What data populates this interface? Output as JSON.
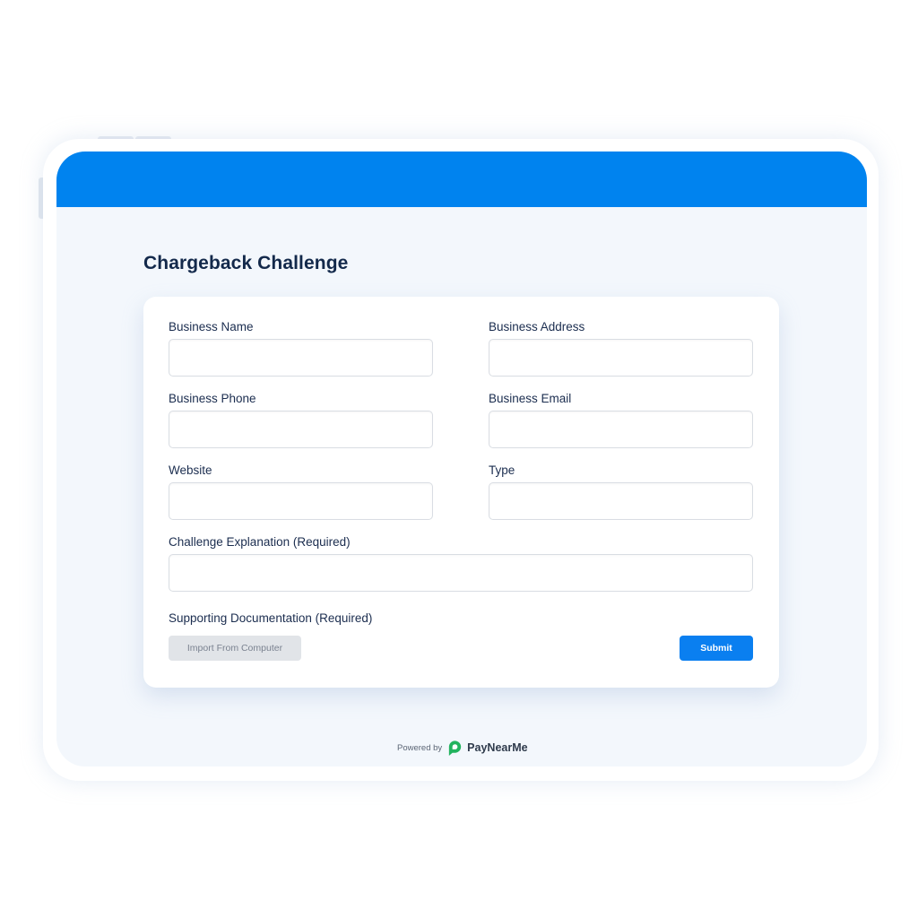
{
  "colors": {
    "header_blue": "#0083ef",
    "submit_blue": "#0a7ff0",
    "logo_green": "#22b35e"
  },
  "form": {
    "title": "Chargeback Challenge",
    "fields": {
      "business_name": {
        "label": "Business Name",
        "value": ""
      },
      "business_address": {
        "label": "Business Address",
        "value": ""
      },
      "business_phone": {
        "label": "Business Phone",
        "value": ""
      },
      "business_email": {
        "label": "Business Email",
        "value": ""
      },
      "website": {
        "label": "Website",
        "value": ""
      },
      "type": {
        "label": "Type",
        "value": ""
      },
      "challenge_explanation": {
        "label": "Challenge Explanation (Required)",
        "value": ""
      }
    },
    "documentation_label": "Supporting Documentation (Required)",
    "import_button": "Import From Computer",
    "submit_button": "Submit"
  },
  "footer": {
    "powered_by": "Powered by",
    "brand_icon": "paynearme-logo-icon",
    "brand_name": "PayNearMe"
  }
}
